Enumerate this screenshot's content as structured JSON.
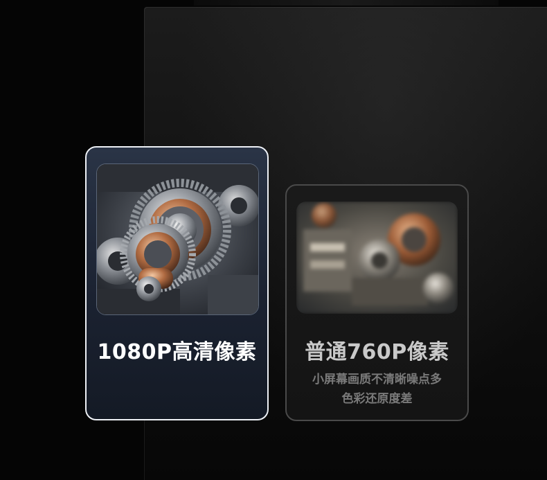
{
  "comparison": {
    "hd": {
      "title": "1080P高清像素",
      "image": "sharp-mechanical-gears",
      "accent": "#eef1f6"
    },
    "sd": {
      "title": "普通760P像素",
      "desc_line1": "小屏幕画质不清晰噪点多",
      "desc_line2": "色彩还原度差",
      "image": "blurred-engine-parts",
      "accent": "#4a4a4a"
    }
  }
}
